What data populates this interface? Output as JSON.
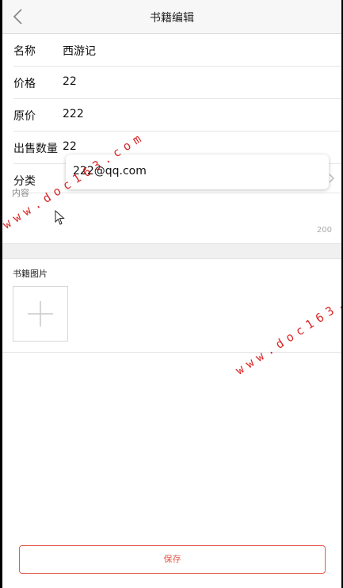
{
  "navbar": {
    "title": "书籍编辑"
  },
  "form": {
    "name": {
      "label": "名称",
      "value": "西游记"
    },
    "price": {
      "label": "价格",
      "value": "22"
    },
    "original_price": {
      "label": "原价",
      "value": "222"
    },
    "sold_quantity": {
      "label": "出售数量",
      "value": "22"
    },
    "category": {
      "label": "分类"
    }
  },
  "autocomplete": {
    "suggestion": "222@qq.com"
  },
  "content": {
    "placeholder": "内容",
    "max_length": "200"
  },
  "images": {
    "title": "书籍图片"
  },
  "save_label": "保存",
  "watermark": {
    "text": "www.doc163.com"
  },
  "colors": {
    "accent": "#e55a4e",
    "watermark": "#d40000"
  },
  "icons": {
    "back": "chevron-left-icon",
    "category_arrow": "chevron-right-icon",
    "add_image": "plus-icon",
    "cursor": "mouse-pointer-icon"
  }
}
